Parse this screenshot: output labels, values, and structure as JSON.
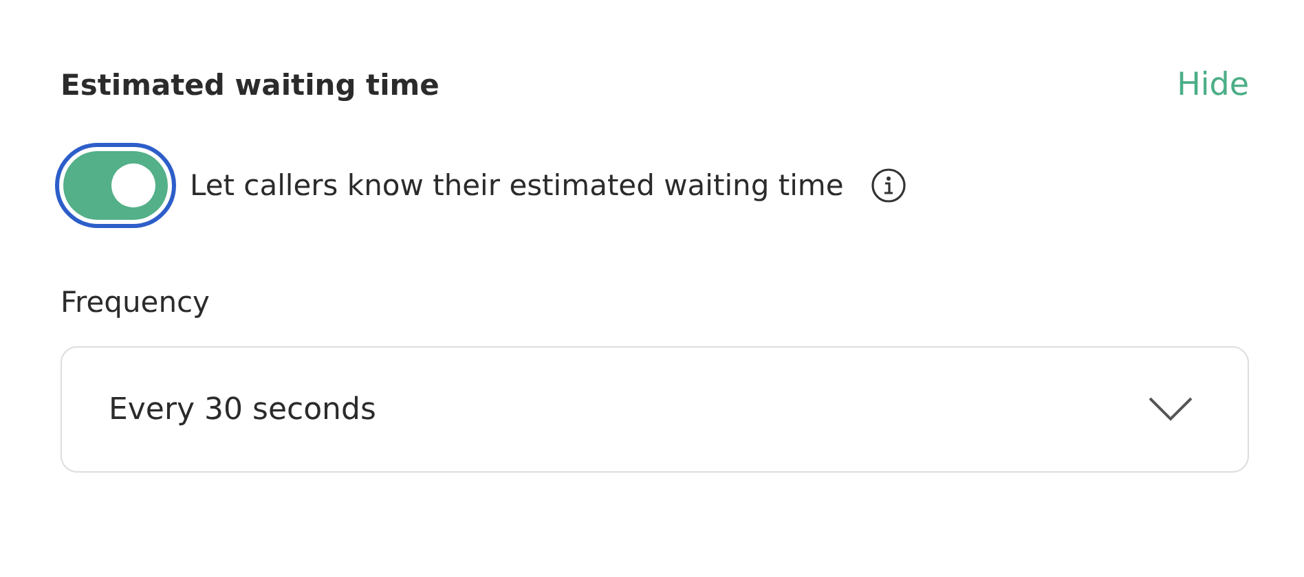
{
  "section": {
    "title": "Estimated waiting time",
    "hide_link": "Hide"
  },
  "toggle": {
    "label": "Let callers know their estimated waiting time",
    "on": true,
    "focused": true
  },
  "frequency": {
    "label": "Frequency",
    "value": "Every 30 seconds"
  }
}
